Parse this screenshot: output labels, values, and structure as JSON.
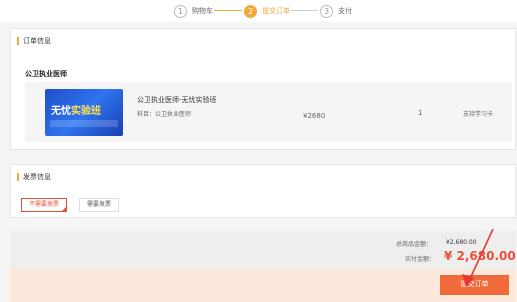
{
  "steps": [
    {
      "num": "1",
      "label": "购物车"
    },
    {
      "num": "2",
      "label": "提交订单"
    },
    {
      "num": "3",
      "label": "支付"
    }
  ],
  "order_section": {
    "title": "订单信息",
    "course_title": "公卫执业医师",
    "item": {
      "thumb_brand": "",
      "thumb_text_main": "无忧",
      "thumb_text_highlight": "实验班",
      "thumb_sub": "",
      "name": "公卫执业医师-无忧实验班",
      "subject": "科目：公卫执业医师",
      "price": "¥2680",
      "quantity": "1",
      "payment": "支持学习卡"
    }
  },
  "invoice_section": {
    "title": "发票信息",
    "options": [
      "不需要发票",
      "需要发票"
    ]
  },
  "summary": {
    "total_label": "总商品金额：",
    "total_value": "¥2,680.00",
    "paid_label": "实付金额：",
    "paid_value": "¥ 2,680.00"
  },
  "submit_label": "提交订单",
  "colors": {
    "accent": "#f2a93b",
    "price_red": "#e8523a",
    "submit": "#f06a3c",
    "annotation_arrow": "#e53935"
  }
}
